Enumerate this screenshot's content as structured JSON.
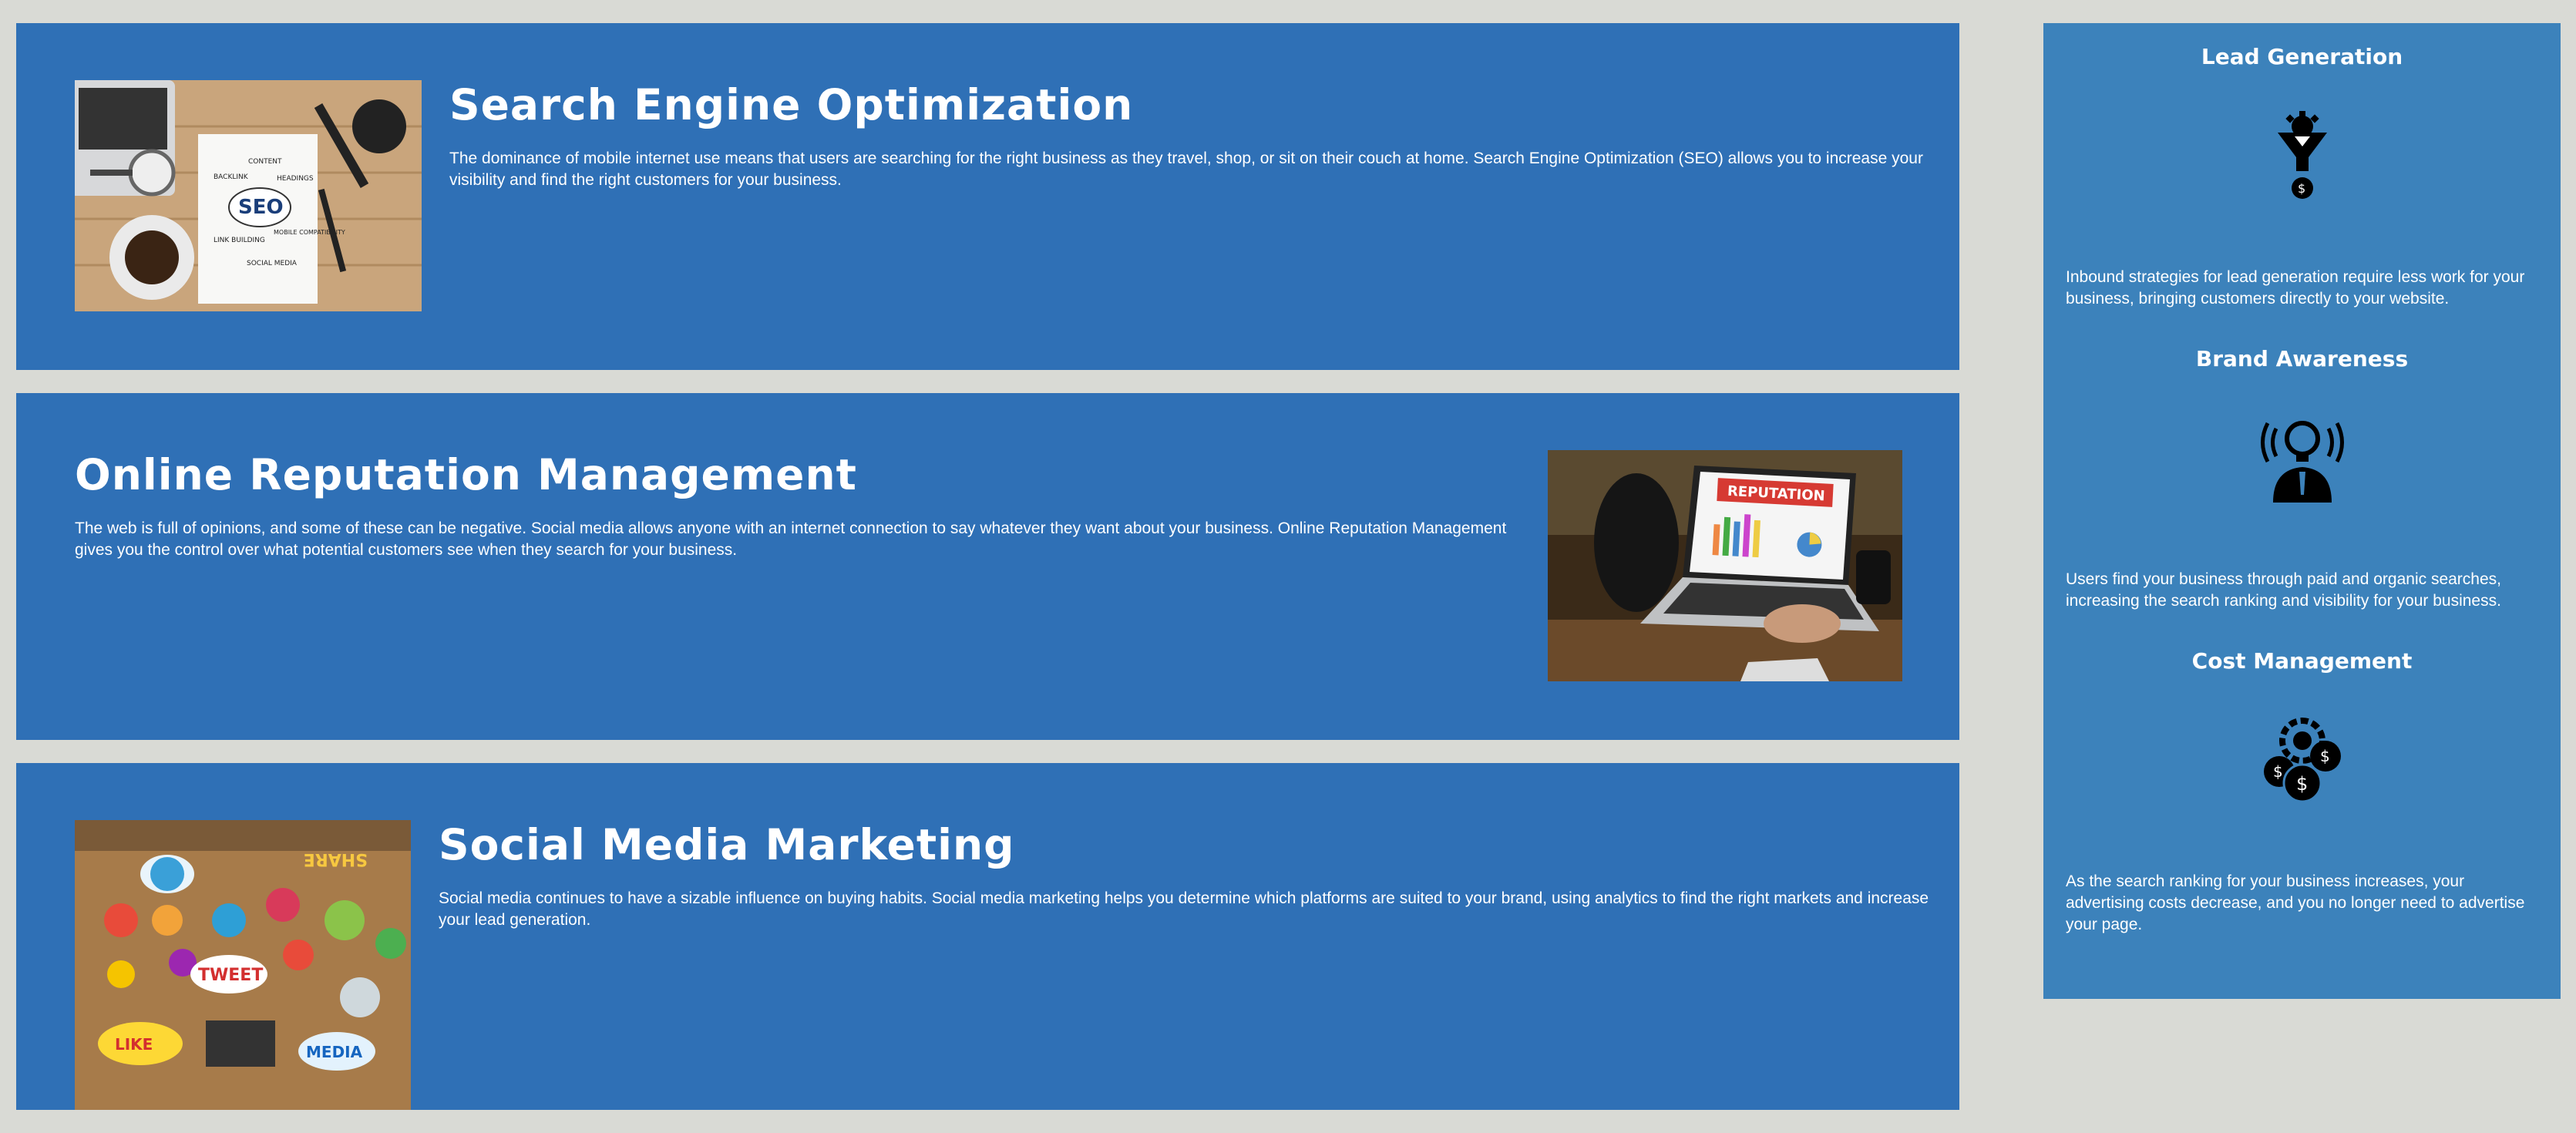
{
  "sections": [
    {
      "title": "Search Engine Optimization",
      "text": "The dominance of mobile internet use means that users are searching for the right business as they travel, shop, or sit on their couch at home. Search Engine Optimization (SEO) allows you to increase your visibility and find the right customers for your business.",
      "image_labels": [
        "CONTENT",
        "BACKLINK",
        "HEADINGS",
        "SEO",
        "LINK BUILDING",
        "MOBILE COMPATIBILITY",
        "SOCIAL MEDIA"
      ]
    },
    {
      "title": "Online Reputation Management",
      "text": "The web is full of opinions, and some of these can be negative. Social media allows anyone with an internet connection to say whatever they want about your business. Online Reputation Management gives you the control over what potential customers see when they search for your business.",
      "image_labels": [
        "REPUTATION"
      ]
    },
    {
      "title": "Social Media Marketing",
      "text": "Social media continues to have a sizable influence on buying habits. Social media marketing helps you determine which platforms are suited to your brand, using analytics to find the right markets and increase your lead generation.",
      "image_labels": [
        "SHARE",
        "TWEET",
        "LIKE",
        "MEDIA"
      ]
    }
  ],
  "benefits": [
    {
      "title": "Lead Generation",
      "icon": "lead-funnel-icon",
      "text": "Inbound strategies for lead generation require less work for your business, bringing customers directly to your website."
    },
    {
      "title": "Brand Awareness",
      "icon": "lightbulb-person-icon",
      "text": "Users find your business through paid and organic searches, increasing the search ranking and visibility for your business."
    },
    {
      "title": "Cost Management",
      "icon": "coins-gear-icon",
      "text": "As the search ranking for your business increases, your advertising costs decrease, and you no longer need to advertise your page."
    }
  ],
  "colors": {
    "page_background": "#d9dad5",
    "section_background": "#2f70b6",
    "benefits_background": "#3c82bb",
    "text": "#ffffff"
  }
}
